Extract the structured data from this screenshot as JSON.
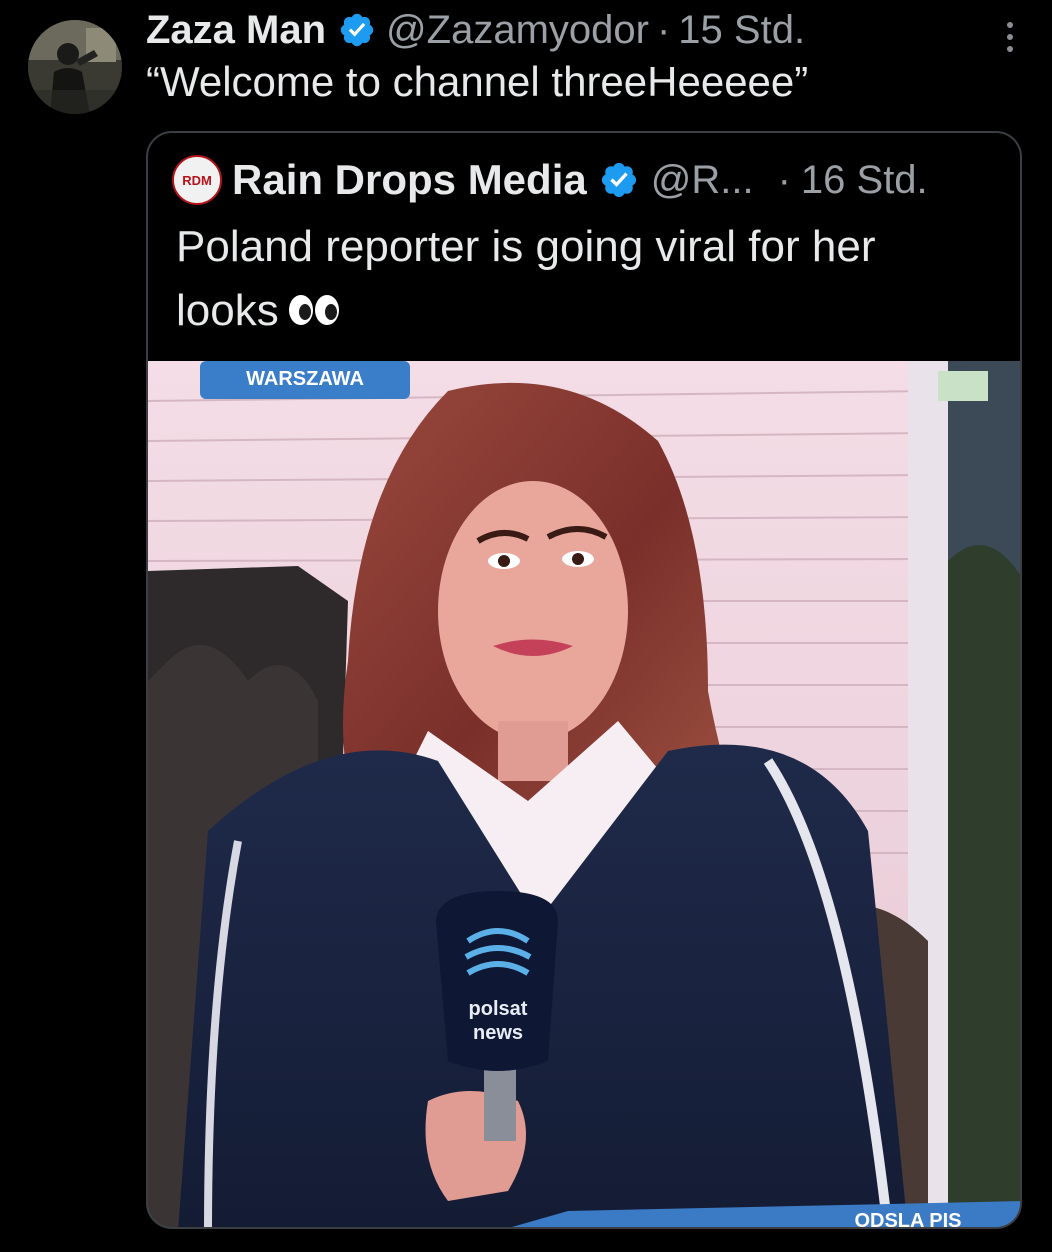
{
  "tweet": {
    "author": {
      "display_name": "Zaza Man",
      "handle": "@Zazamyodor",
      "verified": true
    },
    "separator": "·",
    "time": "15 Std.",
    "text": "“Welcome to channel threeHeeeee”",
    "more_icon": "more-vertical-icon"
  },
  "quoted_tweet": {
    "author": {
      "display_name": "Rain Drops Media",
      "handle": "@R...",
      "verified": true,
      "avatar_text": "RDM"
    },
    "separator": "·",
    "time": "16 Std.",
    "text_line1": "Poland  reporter is going viral for her",
    "text_line2": "looks",
    "emoji": "eyes-emoji",
    "media": {
      "location_tag": "WARSZAWA",
      "mic_brand_line1": "polsat",
      "mic_brand_line2": "news",
      "ticker_fragment": "ODSLA PIS"
    }
  },
  "colors": {
    "background": "#000000",
    "text_primary": "#e7e9ea",
    "text_secondary": "#9aa0a6",
    "verified_blue": "#1d9bf0",
    "border": "#3b3f44"
  }
}
